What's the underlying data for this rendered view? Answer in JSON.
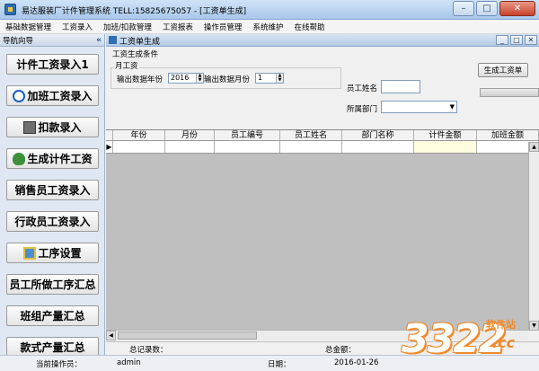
{
  "window": {
    "title": "易达服装厂计件管理系统  TELL:15825675057 - [工资单生成]",
    "minimize_glyph": "–",
    "maximize_glyph": "□",
    "close_glyph": "✕"
  },
  "menu": [
    "基础数据管理",
    "工资录入",
    "加班/扣款管理",
    "工资报表",
    "操作员管理",
    "系统维护",
    "在线帮助"
  ],
  "nav": {
    "title": "导航向导",
    "collapse_glyph": "«",
    "items": [
      {
        "label": "计件工资录入1",
        "icon": "none"
      },
      {
        "label": "加班工资录入",
        "icon": "arrows-icon"
      },
      {
        "label": "扣款录入",
        "icon": "deduct-icon"
      },
      {
        "label": "生成计件工资",
        "icon": "money-bag-icon"
      },
      {
        "label": "销售员工资录入",
        "icon": "none"
      },
      {
        "label": "行政员工资录入",
        "icon": "none"
      },
      {
        "label": "工序设置",
        "icon": "gear-icon"
      },
      {
        "label": "员工所做工序汇总",
        "icon": "none"
      },
      {
        "label": "班组产量汇总",
        "icon": "none"
      },
      {
        "label": "款式产量汇总",
        "icon": "none"
      }
    ]
  },
  "child_window": {
    "title": "工资单生成",
    "min_glyph": "_",
    "max_glyph": "□",
    "close_glyph": "✕"
  },
  "form": {
    "section_label": "工资生成条件",
    "group_title": "月工资",
    "year_label": "输出数据年份",
    "year_value": "2016",
    "month_label": "输出数据月份",
    "month_value": "1",
    "employee_name_label": "员工姓名",
    "employee_name_value": "",
    "department_label": "所属部门",
    "department_value": "",
    "generate_button": "生成工资单"
  },
  "grid": {
    "columns": [
      "",
      "年份",
      "月份",
      "员工编号",
      "员工姓名",
      "部门名称",
      "计件金额",
      "加班金额"
    ],
    "rows": [
      [
        "▶",
        "",
        "",
        "",
        "",
        "",
        "",
        ""
      ]
    ]
  },
  "summary": {
    "total_records_label": "总记录数：",
    "total_amount_label": "总金额："
  },
  "statusbar": {
    "operator_label": "当前操作员：",
    "operator_value": "admin",
    "date_label": "日期：",
    "date_value": "2016-01-26"
  },
  "watermark": {
    "number": "3322",
    "site": "软件站",
    "domain": ".cc"
  },
  "colors": {
    "accent": "#2e6eb4",
    "watermark": "#f08a2a"
  }
}
